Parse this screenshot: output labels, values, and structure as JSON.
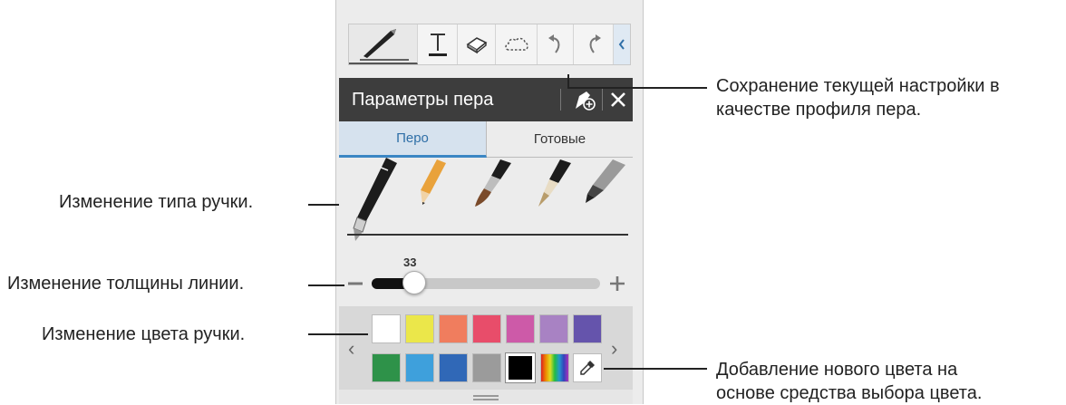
{
  "toolbar": {
    "tools": [
      "pen-icon",
      "text-icon",
      "eraser-icon",
      "lasso-icon",
      "undo-icon",
      "redo-icon",
      "chevron-left-icon"
    ]
  },
  "panel": {
    "title": "Параметры пера",
    "tabs": [
      {
        "label": "Перо",
        "selected": true
      },
      {
        "label": "Готовые",
        "selected": false
      }
    ],
    "thickness": {
      "value": "33",
      "minus": "−",
      "plus": "+"
    },
    "palette": {
      "row1": [
        "#ffffff",
        "#ebe74a",
        "#f07d5e",
        "#e84d6a",
        "#cd5aa8",
        "#a882c3",
        "#6554ac"
      ],
      "row2": [
        "#2e9249",
        "#3ea0dc",
        "#3068b7",
        "#9b9b9b",
        "#000000"
      ],
      "prev": "‹",
      "next": "›"
    },
    "pen_types": [
      "ballpoint",
      "pencil",
      "brush",
      "calligraphy",
      "marker"
    ]
  },
  "callouts": {
    "save_profile": [
      "Сохранение текущей настройки в",
      "качестве профиля пера."
    ],
    "pen_type": "Изменение типа ручки.",
    "line_thickness": "Изменение толщины линии.",
    "pen_color": "Изменение цвета ручки.",
    "add_color": [
      "Добавление нового цвета на",
      "основе средства выбора цвета."
    ]
  },
  "colors": {
    "header_bg": "#3d3d3d",
    "tab_active_text": "#2f6fa7",
    "tab_active_bg": "#d6e2ee"
  }
}
